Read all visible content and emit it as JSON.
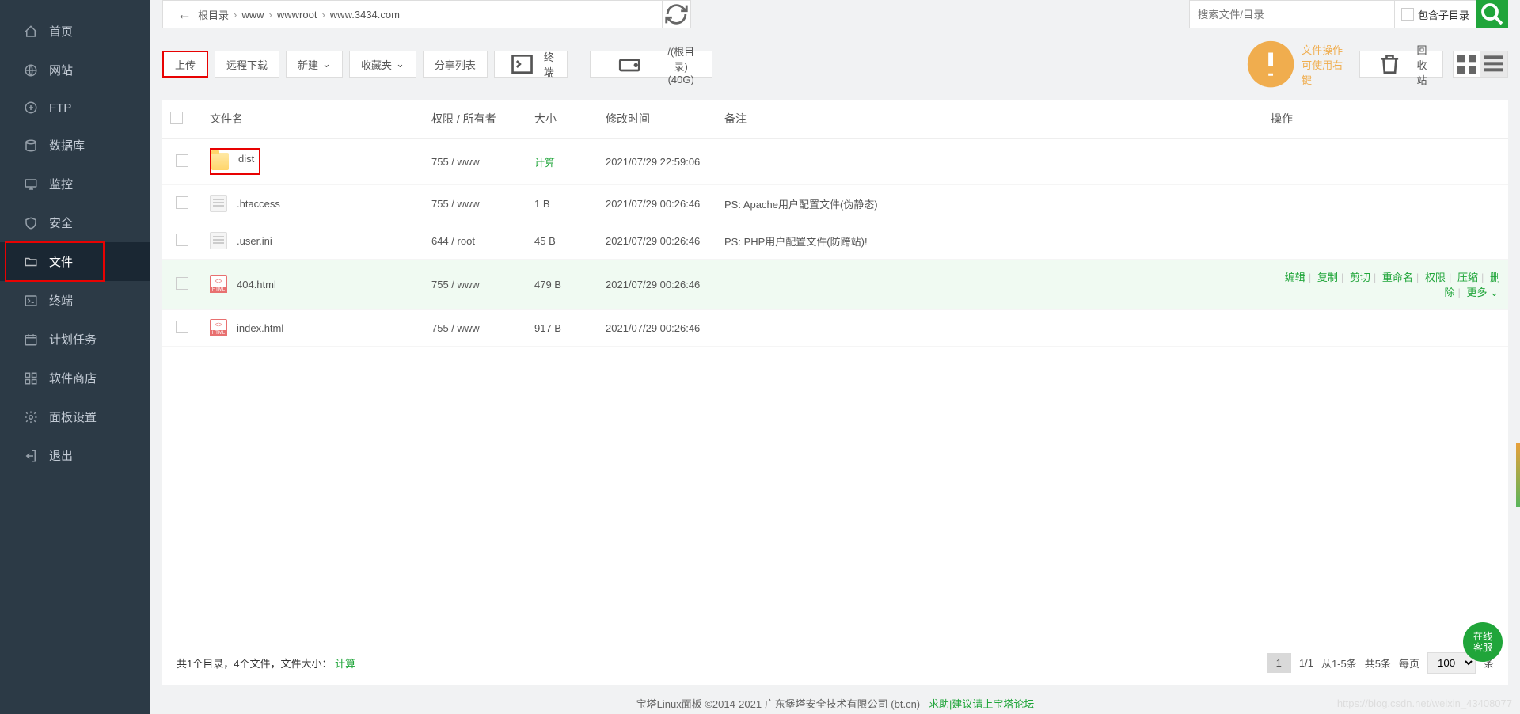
{
  "sidebar": {
    "items": [
      {
        "label": "首页",
        "icon": "home-icon"
      },
      {
        "label": "网站",
        "icon": "globe-icon"
      },
      {
        "label": "FTP",
        "icon": "ftp-icon"
      },
      {
        "label": "数据库",
        "icon": "database-icon"
      },
      {
        "label": "监控",
        "icon": "monitor-icon"
      },
      {
        "label": "安全",
        "icon": "shield-icon"
      },
      {
        "label": "文件",
        "icon": "folder-icon",
        "active": true,
        "highlighted": true
      },
      {
        "label": "终端",
        "icon": "terminal-icon"
      },
      {
        "label": "计划任务",
        "icon": "calendar-icon"
      },
      {
        "label": "软件商店",
        "icon": "apps-icon"
      },
      {
        "label": "面板设置",
        "icon": "gear-icon"
      },
      {
        "label": "退出",
        "icon": "logout-icon"
      }
    ]
  },
  "breadcrumb": {
    "items": [
      "根目录",
      "www",
      "wwwroot",
      "www.3434.com"
    ]
  },
  "search": {
    "placeholder": "搜索文件/目录",
    "include_subdirs_label": "包含子目录"
  },
  "toolbar": {
    "upload": "上传",
    "remote_download": "远程下载",
    "new": "新建",
    "favorites": "收藏夹",
    "share_list": "分享列表",
    "terminal": "终端",
    "root_disk": "/(根目录) (40G)",
    "tip": "文件操作可使用右键",
    "recycle_bin": "回收站"
  },
  "table": {
    "headers": {
      "filename": "文件名",
      "permission": "权限 / 所有者",
      "size": "大小",
      "mtime": "修改时间",
      "remark": "备注",
      "ops": "操作"
    },
    "rows": [
      {
        "type": "folder",
        "name": "dist",
        "perm": "755 / www",
        "size": "计算",
        "size_link": true,
        "mtime": "2021/07/29 22:59:06",
        "remark": "",
        "highlighted": true
      },
      {
        "type": "text",
        "name": ".htaccess",
        "perm": "755 / www",
        "size": "1 B",
        "mtime": "2021/07/29 00:26:46",
        "remark": "PS: Apache用户配置文件(伪静态)"
      },
      {
        "type": "text",
        "name": ".user.ini",
        "perm": "644 / root",
        "size": "45 B",
        "mtime": "2021/07/29 00:26:46",
        "remark": "PS: PHP用户配置文件(防跨站)!"
      },
      {
        "type": "html",
        "name": "404.html",
        "perm": "755 / www",
        "size": "479 B",
        "mtime": "2021/07/29 00:26:46",
        "remark": "",
        "hover": true
      },
      {
        "type": "html",
        "name": "index.html",
        "perm": "755 / www",
        "size": "917 B",
        "mtime": "2021/07/29 00:26:46",
        "remark": ""
      }
    ],
    "row_ops": {
      "edit": "编辑",
      "copy": "复制",
      "cut": "剪切",
      "rename": "重命名",
      "perm": "权限",
      "compress": "压缩",
      "delete": "删除",
      "more": "更多"
    }
  },
  "footer": {
    "summary_prefix": "共1个目录，4个文件，文件大小：",
    "calculate": "计算",
    "page_current": "1",
    "page_total": "1/1",
    "range": "从1-5条",
    "total": "共5条",
    "per_page_label": "每页",
    "per_page_value": "100",
    "per_page_suffix": "条"
  },
  "credits": {
    "text": "宝塔Linux面板 ©2014-2021 广东堡塔安全技术有限公司 (bt.cn)",
    "help_label": "求助|建议请上宝塔论坛"
  },
  "watermark": "https://blog.csdn.net/weixin_43408077",
  "float_btn": "在线\n客服"
}
